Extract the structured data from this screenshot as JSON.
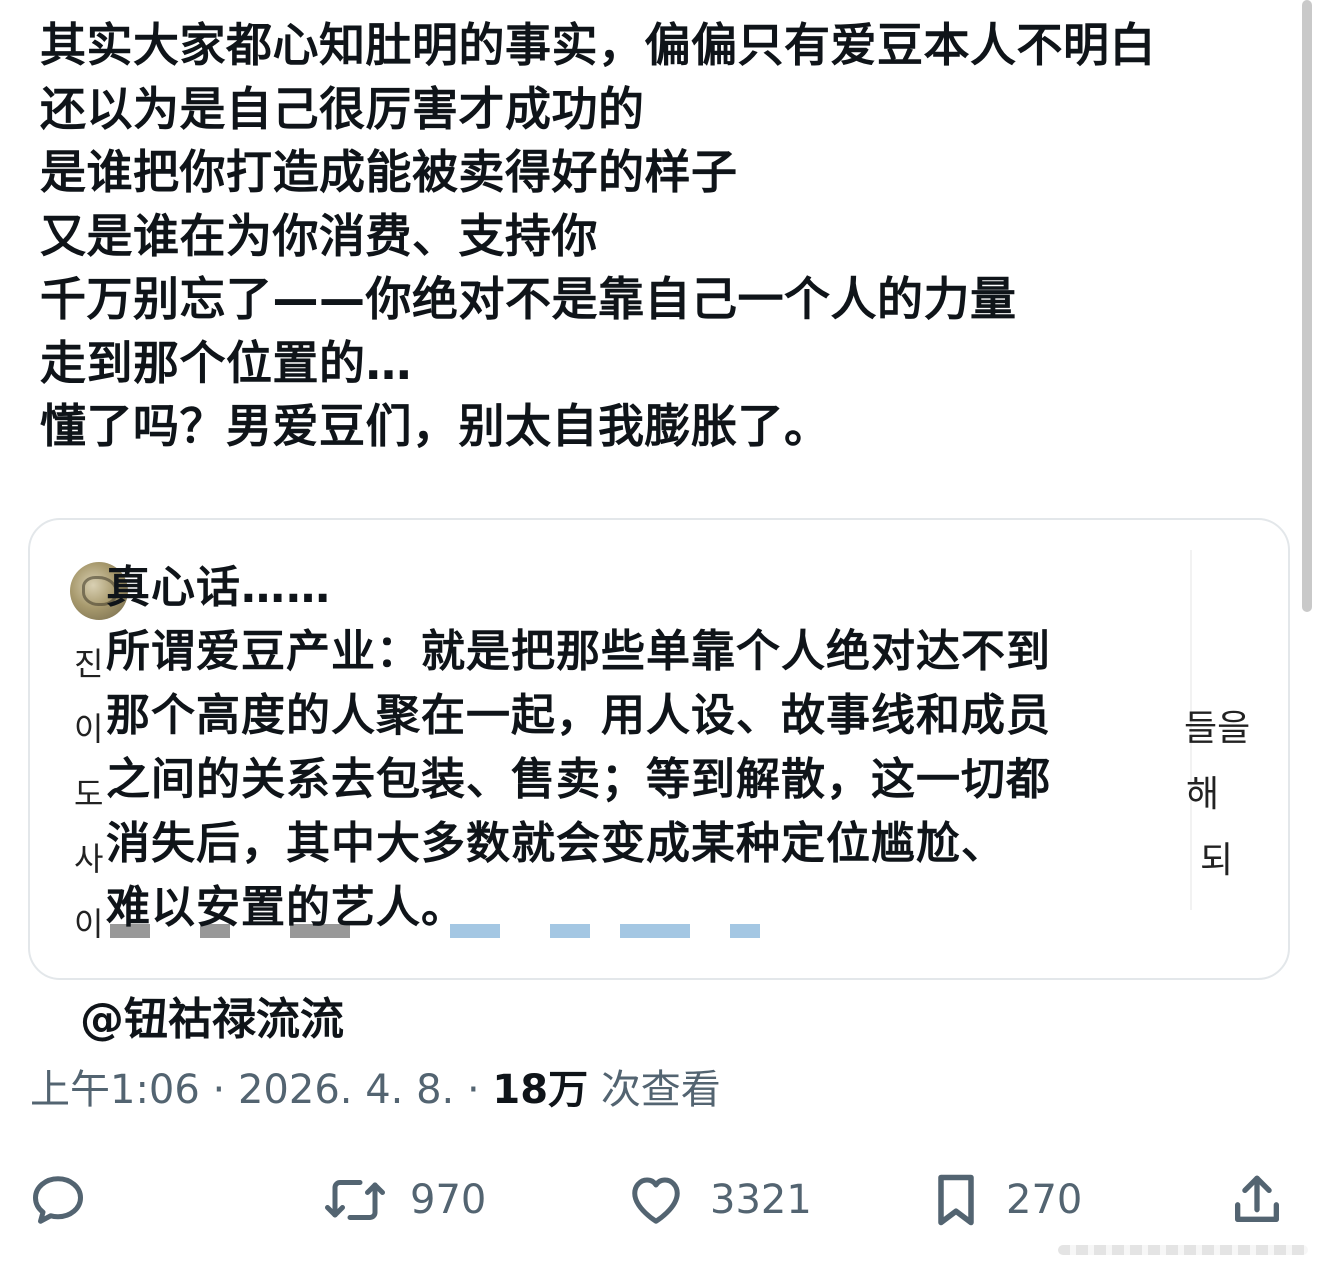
{
  "tweet": {
    "lines": [
      "其实大家都心知肚明的事实，偏偏只有爱豆本人不明白",
      "还以为是自己很厉害才成功的",
      "是谁把你打造成能被卖得好的样子",
      "又是谁在为你消费、支持你",
      "千万别忘了——你绝对不是靠自己一个人的力量",
      "走到那个位置的…",
      "懂了吗？男爱豆们，别太自我膨胀了。"
    ]
  },
  "quote": {
    "lines": [
      "真心话……",
      "所谓爱豆产业：就是把那些单靠个人绝对达不到",
      "那个高度的人聚在一起，用人设、故事线和成员",
      "之间的关系去包装、售卖；等到解散，这一切都",
      "消失后，其中大多数就会变成某种定位尴尬、",
      "难以安置的艺人。"
    ],
    "bg_left": [
      "진",
      "이",
      "도",
      "사",
      "이"
    ],
    "bg_right": [
      "들을",
      "해",
      "되"
    ]
  },
  "mention": "@钮祜禄流流",
  "meta": {
    "time": "上午1:06",
    "separator": "·",
    "date": "2026. 4. 8.",
    "views_count": "18万",
    "views_label": "次查看"
  },
  "actions": {
    "retweets": "970",
    "likes": "3321",
    "bookmarks": "270"
  },
  "colors": {
    "text": "#0f1419",
    "secondary": "#536471",
    "border": "#e3e7ea"
  },
  "icons": [
    "reply-icon",
    "retweet-icon",
    "heart-icon",
    "bookmark-icon",
    "share-icon"
  ]
}
